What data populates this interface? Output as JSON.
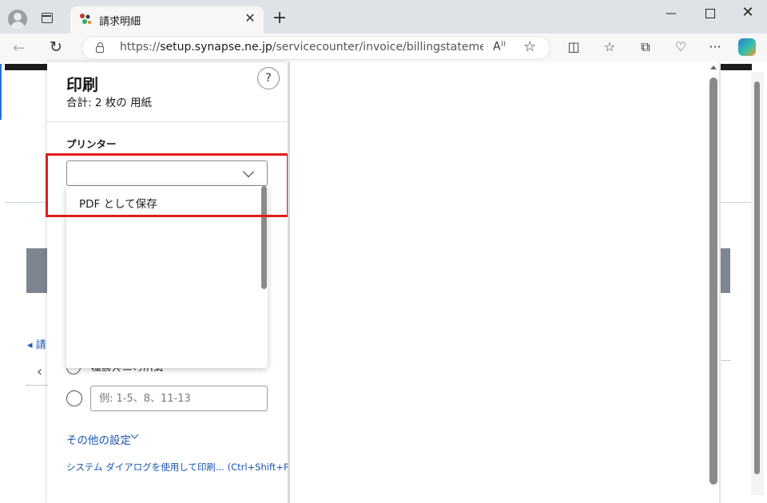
{
  "browser": {
    "tab": {
      "title": "請求明細"
    },
    "url": {
      "prefix": "https://",
      "host": "setup.synapse.ne.jp",
      "path": "/servicecounter/invoice/billingstatement?billi..."
    },
    "icons": {
      "profile": "profile-avatar-icon",
      "tab_actions": "tab-actions-icon",
      "close_tab": "close-icon",
      "new_tab": "plus-icon",
      "back": "back-arrow-icon",
      "reload": "reload-icon",
      "lock": "lock-icon",
      "read_aloud": "read-aloud-icon",
      "favorite": "star-icon",
      "split_screen": "split-screen-icon",
      "favorites": "favorites-icon",
      "collections": "collections-icon",
      "browser_essentials": "heart-pulse-icon",
      "more": "more-icon",
      "copilot": "copilot-icon"
    }
  },
  "print_dialog": {
    "title": "印刷",
    "sheet_total": "合計: 2 枚の 用紙",
    "help_label": "?",
    "printer": {
      "label": "プリンター",
      "selected": "",
      "options": [
        "PDF として保存"
      ]
    },
    "pages": {
      "partial_option_text": "偶数ページのみ",
      "custom_placeholder": "例: 1-5、8、11-13"
    },
    "more_settings": "その他の設定",
    "system_dialog_link": "システム ダイアログを使用して印刷... (Ctrl+Shift+P)"
  },
  "background_page": {
    "link_fragment": "請",
    "chevron": "‹"
  },
  "colors": {
    "link": "#1a56b0",
    "highlight_box": "#e01d1d",
    "tab_bar": "#dfe3e8"
  }
}
